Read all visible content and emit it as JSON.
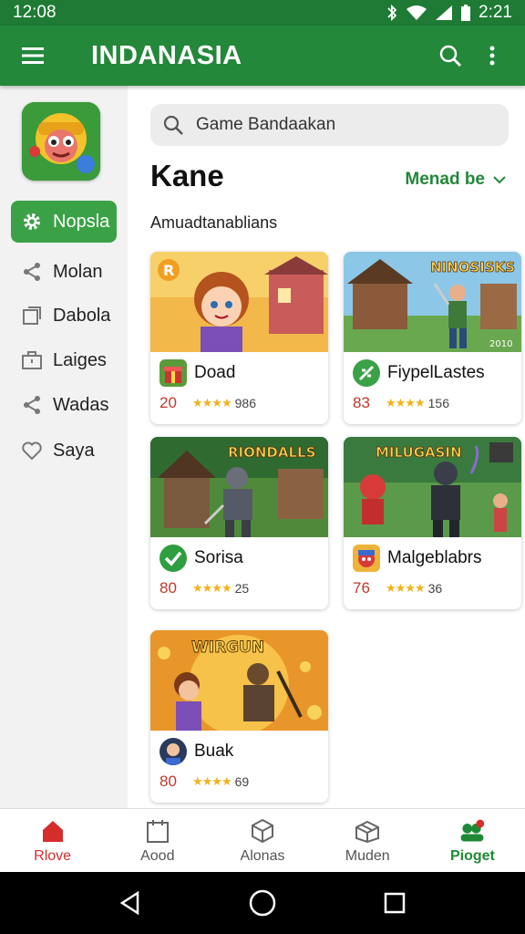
{
  "status": {
    "time_left": "12:08",
    "time_right": "2:21"
  },
  "appbar": {
    "title": "INDANASIA",
    "icons": [
      "menu-icon",
      "search-icon",
      "more-vert-icon"
    ]
  },
  "sidebar": {
    "items": [
      {
        "label": "Nopsla",
        "icon": "gear-icon",
        "active": true
      },
      {
        "label": "Molan",
        "icon": "share-icon"
      },
      {
        "label": "Dabola",
        "icon": "square-icon"
      },
      {
        "label": "Laiges",
        "icon": "briefcase-icon"
      },
      {
        "label": "Wadas",
        "icon": "share-icon"
      },
      {
        "label": "Saya",
        "icon": "heart-icon"
      }
    ]
  },
  "search": {
    "placeholder": "Game Bandaakan"
  },
  "section": {
    "title": "Kane",
    "sort_label": "Menad be",
    "subtitle": "Amuadtanablians"
  },
  "games": [
    {
      "name": "Doad",
      "price": "20",
      "rating": "986",
      "badge": "",
      "thumb_text": ""
    },
    {
      "name": "FiypelLastes",
      "price": "83",
      "rating": "156",
      "badge": "2010",
      "thumb_text": "NINOSISKS"
    },
    {
      "name": "Sorisa",
      "price": "80",
      "rating": "25",
      "badge": "",
      "thumb_text": "RIONDALLS"
    },
    {
      "name": "Malgeblabrs",
      "price": "76",
      "rating": "36",
      "badge": "",
      "thumb_text": "MILUGASIN"
    },
    {
      "name": "Buak",
      "price": "80",
      "rating": "69",
      "badge": "",
      "thumb_text": "WIRGUN"
    }
  ],
  "stars": "★★★★",
  "bottom_nav": [
    {
      "label": "Rlove",
      "icon": "home-icon"
    },
    {
      "label": "Aood",
      "icon": "calendar-icon"
    },
    {
      "label": "Alonas",
      "icon": "cube-icon"
    },
    {
      "label": "Muden",
      "icon": "box-icon"
    },
    {
      "label": "Pioget",
      "icon": "people-icon"
    }
  ],
  "colors": {
    "primary": "#23883a",
    "status": "#1e7a34",
    "accent_red": "#d62c2c",
    "star": "#f2b21b"
  }
}
